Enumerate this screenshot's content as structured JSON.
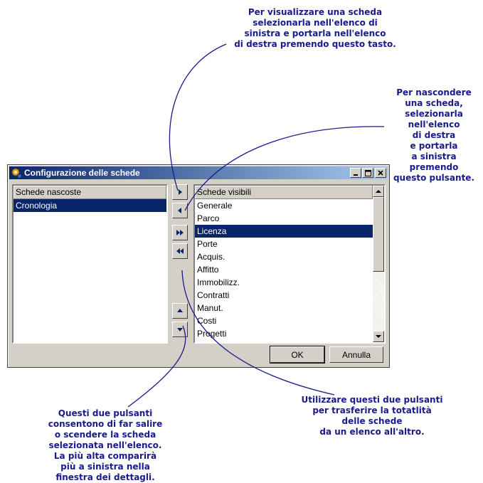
{
  "callouts": {
    "top": "Per visualizzare una scheda\nselezionarla nell'elenco di\nsinistra e portarla nell'elenco\ndi destra premendo questo tasto.",
    "right": "Per nascondere\nuna scheda,\nselezionarla\nnell'elenco\ndi destra\ne portarla\na sinistra\npremendo\nquesto pulsante.",
    "bottom_left": "Questi due pulsanti\nconsentono di far salire\no scendere la scheda\nselezionata nell'elenco.\nLa più alta comparirà\npiù a sinistra nella\nfinestra dei dettagli.",
    "bottom_right": "Utilizzare questi due pulsanti\nper trasferire la totatlità\ndelle schede\nda un elenco all'altro."
  },
  "window": {
    "title": "Configurazione delle schede",
    "icon": "app-config-icon"
  },
  "left_list": {
    "header": "Schede nascoste",
    "items": [
      "Cronologia"
    ],
    "selected_index": 0
  },
  "right_list": {
    "header": "Schede visibili",
    "items": [
      "Generale",
      "Parco",
      "Licenza",
      "Porte",
      "Acquis.",
      "Affitto",
      "Immobilizz.",
      "Contratti",
      "Manut.",
      "Costi",
      "Progetti"
    ],
    "selected_index": 2
  },
  "buttons": {
    "ok": "OK",
    "cancel": "Annulla"
  },
  "icons": {
    "move_right": "chevron-right-icon",
    "move_left": "chevron-left-icon",
    "move_all_right": "double-chevron-right-icon",
    "move_all_left": "double-chevron-left-icon",
    "move_up": "triangle-up-icon",
    "move_down": "triangle-down-icon"
  },
  "colors": {
    "callout_text": "#1a1a8c",
    "title_bar": "#0a246a",
    "selection": "#0a246a",
    "window_face": "#d4d0c8"
  }
}
